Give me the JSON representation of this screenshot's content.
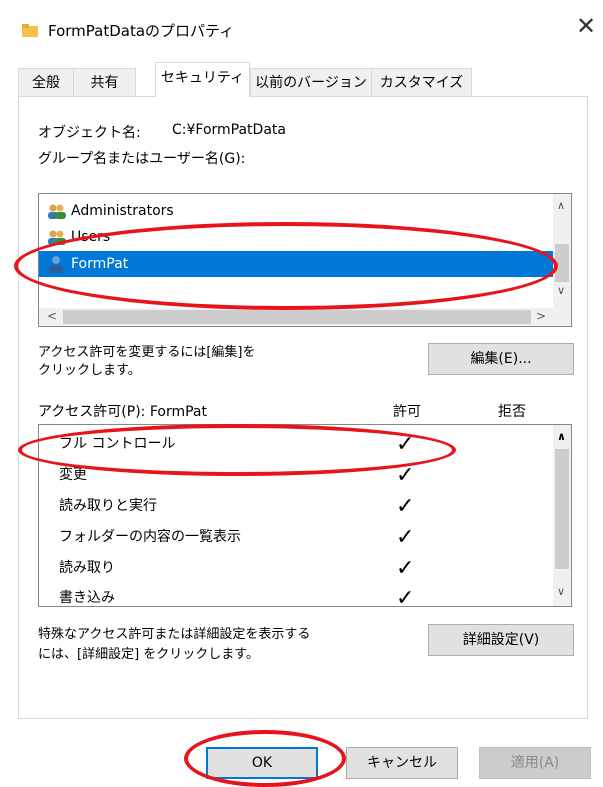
{
  "window": {
    "title": "FormPatDataのプロパティ",
    "close_glyph": "✕"
  },
  "tabs": [
    {
      "label": "全般"
    },
    {
      "label": "共有"
    },
    {
      "label": "セキュリティ"
    },
    {
      "label": "以前のバージョン"
    },
    {
      "label": "カスタマイズ"
    }
  ],
  "security": {
    "object_name_label": "オブジェクト名:",
    "object_name_value": "C:¥FormPatData",
    "groups_label": "グループ名またはユーザー名(G):",
    "groups": [
      {
        "name": "Administrators",
        "icon": "group-users-icon"
      },
      {
        "name": "Users",
        "icon": "group-users-icon"
      },
      {
        "name": "FormPat",
        "icon": "user-icon",
        "selected": true
      }
    ],
    "edit_hint": "アクセス許可を変更するには[編集]を\nクリックします。",
    "edit_button": "編集(E)...",
    "perm_header": "アクセス許可(P): FormPat",
    "allow_header": "許可",
    "deny_header": "拒否",
    "permissions": [
      {
        "name": "フル コントロール",
        "allow": "✓",
        "deny": ""
      },
      {
        "name": "変更",
        "allow": "✓",
        "deny": ""
      },
      {
        "name": "読み取りと実行",
        "allow": "✓",
        "deny": ""
      },
      {
        "name": "フォルダーの内容の一覧表示",
        "allow": "✓",
        "deny": ""
      },
      {
        "name": "読み取り",
        "allow": "✓",
        "deny": ""
      },
      {
        "name": "書き込み",
        "allow": "✓",
        "deny": ""
      }
    ],
    "advanced_hint": "特殊なアクセス許可または詳細設定を表示する\nには、[詳細設定] をクリックします。",
    "advanced_button": "詳細設定(V)"
  },
  "footer": {
    "ok": "OK",
    "cancel": "キャンセル",
    "apply": "適用(A)"
  },
  "colors": {
    "selection": "#0078d7",
    "annotation": "#e8141b",
    "accent_border": "#0078d7"
  }
}
